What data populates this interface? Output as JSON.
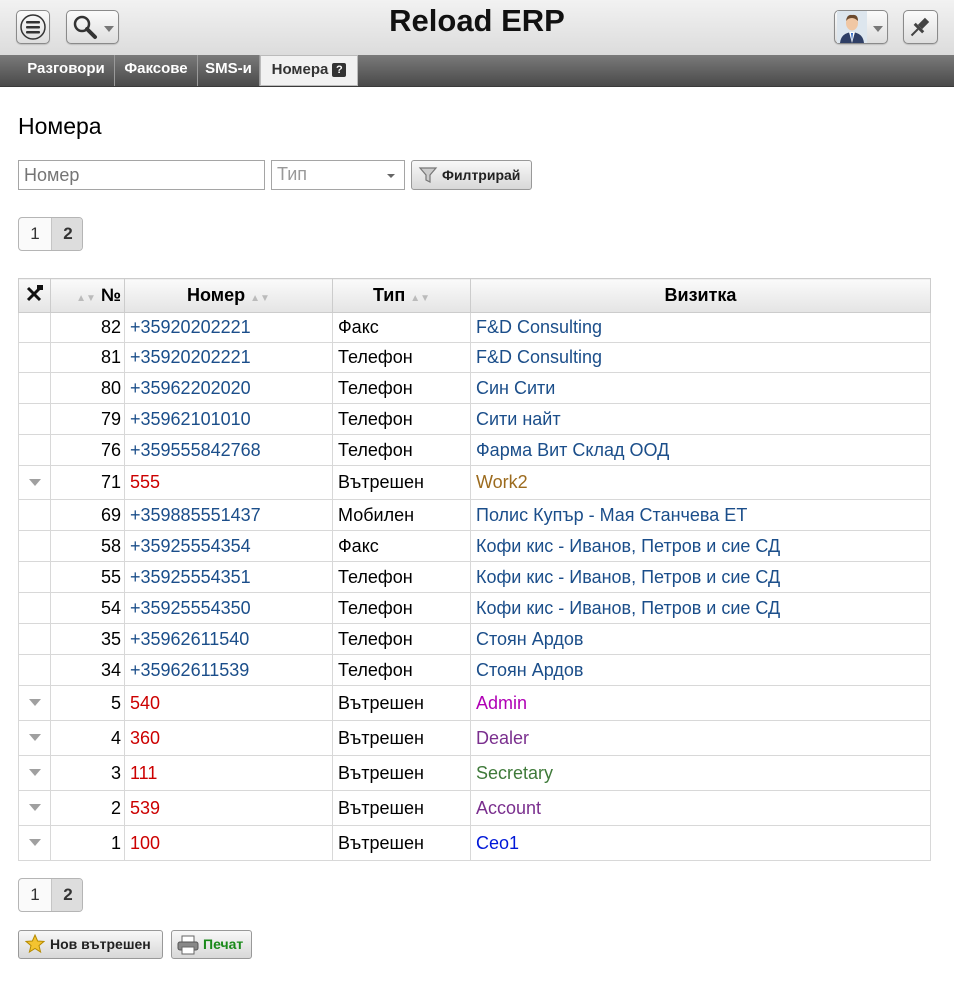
{
  "app": {
    "title": "Reload ERP"
  },
  "tabs": [
    {
      "label": "Разговори"
    },
    {
      "label": "Факсове"
    },
    {
      "label": "SMS-и"
    },
    {
      "label": "Номера",
      "help": "?"
    }
  ],
  "page": {
    "heading": "Номера"
  },
  "filters": {
    "number_placeholder": "Номер",
    "type_placeholder": "Тип",
    "filter_label": "Филтрирай"
  },
  "pager": {
    "pages": [
      "1",
      "2"
    ],
    "current": "2"
  },
  "table": {
    "headers": {
      "no": "№",
      "number": "Номер",
      "type": "Тип",
      "card": "Визитка"
    },
    "rows": [
      {
        "no": "82",
        "number": "+35920202221",
        "type": "Факс",
        "card": "F&D Consulting",
        "card_color": "#1b4e8a",
        "internal": false
      },
      {
        "no": "81",
        "number": "+35920202221",
        "type": "Телефон",
        "card": "F&D Consulting",
        "card_color": "#1b4e8a",
        "internal": false
      },
      {
        "no": "80",
        "number": "+35962202020",
        "type": "Телефон",
        "card": "Син Сити",
        "card_color": "#1b4e8a",
        "internal": false
      },
      {
        "no": "79",
        "number": "+35962101010",
        "type": "Телефон",
        "card": "Сити найт",
        "card_color": "#1b4e8a",
        "internal": false
      },
      {
        "no": "76",
        "number": "+359555842768",
        "type": "Телефон",
        "card": "Фарма Вит Склад ООД",
        "card_color": "#1b4e8a",
        "internal": false
      },
      {
        "no": "71",
        "number": "555",
        "type": "Вътрешен",
        "card": "Work2",
        "card_color": "#9c6b1e",
        "internal": true
      },
      {
        "no": "69",
        "number": "+359885551437",
        "type": "Мобилен",
        "card": "Полис Купър - Мая Станчева ЕТ",
        "card_color": "#1b4e8a",
        "internal": false
      },
      {
        "no": "58",
        "number": "+35925554354",
        "type": "Факс",
        "card": "Кофи кис - Иванов, Петров и сие СД",
        "card_color": "#1b4e8a",
        "internal": false
      },
      {
        "no": "55",
        "number": "+35925554351",
        "type": "Телефон",
        "card": "Кофи кис - Иванов, Петров и сие СД",
        "card_color": "#1b4e8a",
        "internal": false
      },
      {
        "no": "54",
        "number": "+35925554350",
        "type": "Телефон",
        "card": "Кофи кис - Иванов, Петров и сие СД",
        "card_color": "#1b4e8a",
        "internal": false
      },
      {
        "no": "35",
        "number": "+35962611540",
        "type": "Телефон",
        "card": "Стоян Ардов",
        "card_color": "#1b4e8a",
        "internal": false
      },
      {
        "no": "34",
        "number": "+35962611539",
        "type": "Телефон",
        "card": "Стоян Ардов",
        "card_color": "#1b4e8a",
        "internal": false
      },
      {
        "no": "5",
        "number": "540",
        "type": "Вътрешен",
        "card": "Admin",
        "card_color": "#b000b5",
        "internal": true
      },
      {
        "no": "4",
        "number": "360",
        "type": "Вътрешен",
        "card": "Dealer",
        "card_color": "#7a2f8e",
        "internal": true
      },
      {
        "no": "3",
        "number": "111",
        "type": "Вътрешен",
        "card": "Secretary",
        "card_color": "#3f7a3a",
        "internal": true
      },
      {
        "no": "2",
        "number": "539",
        "type": "Вътрешен",
        "card": "Account",
        "card_color": "#7a2f8e",
        "internal": true
      },
      {
        "no": "1",
        "number": "100",
        "type": "Вътрешен",
        "card": "Ceo1",
        "card_color": "#0018d8",
        "internal": true
      }
    ]
  },
  "actions": {
    "new_internal": "Нов вътрешен",
    "print": "Печат",
    "print_color": "#1a8a1a"
  },
  "colors": {
    "link": "#1b4e8a",
    "internal_number": "#cc0000"
  }
}
